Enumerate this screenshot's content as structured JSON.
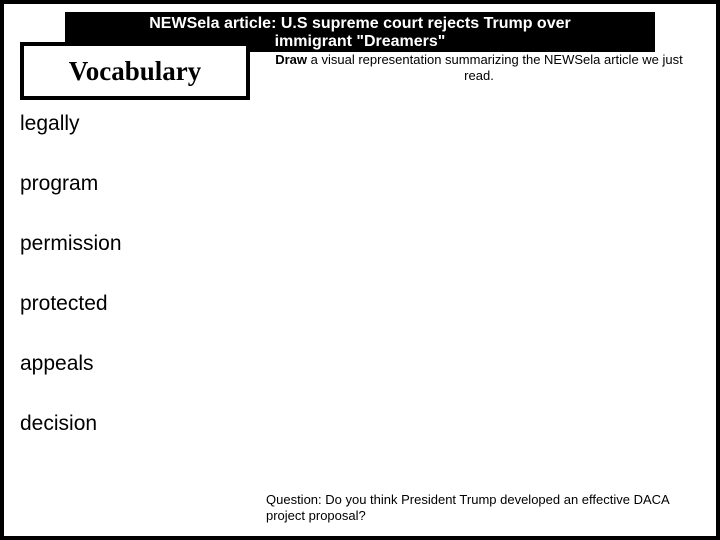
{
  "banner": {
    "line1": "NEWSela article: U.S supreme court rejects Trump over",
    "line2": "immigrant \"Dreamers\""
  },
  "vocab": {
    "title": "Vocabulary",
    "items": [
      "legally",
      "program",
      "permission",
      "protected",
      "appeals",
      "decision"
    ]
  },
  "draw_instruction": {
    "bold": "Draw",
    "rest": " a visual representation summarizing the NEWSela article we just read."
  },
  "question": {
    "text": "Question: Do you think President Trump developed an effective DACA project proposal?"
  }
}
